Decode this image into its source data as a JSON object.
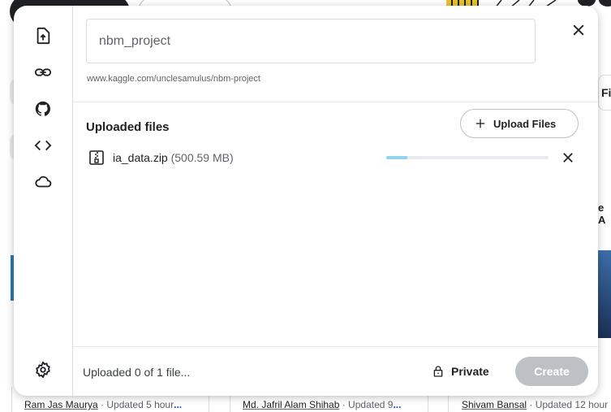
{
  "background": {
    "filter_label": "Filte",
    "side_text": "e A",
    "cards": [
      {
        "author": "Ram Jas Maurya",
        "meta": " · Updated 5 hour",
        "ellipsis": "..."
      },
      {
        "author": "Md. Jafril Alam Shihab",
        "meta": " · Updated 9",
        "ellipsis": "..."
      },
      {
        "author": "Shivam Bansal",
        "meta": " · Updated 12 hour",
        "ellipsis": ""
      }
    ]
  },
  "rail": {
    "items": [
      {
        "name": "upload-file-icon"
      },
      {
        "name": "link-icon"
      },
      {
        "name": "github-icon"
      },
      {
        "name": "code-icon"
      },
      {
        "name": "cloud-icon"
      }
    ],
    "settings_icon": "gear-icon"
  },
  "dataset": {
    "title_value": "nbm_project",
    "url": "www.kaggle.com/unclesamulus/nbm-project"
  },
  "uploads": {
    "section_title": "Uploaded files",
    "upload_button_label": "Upload Files",
    "files": [
      {
        "name": "ia_data.zip",
        "size": "(500.59 MB)",
        "progress": 0.13
      }
    ]
  },
  "footer": {
    "status": "Uploaded 0 of 1 file...",
    "privacy_label": "Private",
    "create_label": "Create"
  },
  "colors": {
    "accent_progress": "#8fd3f0",
    "disabled_button": "#bdc1c6"
  }
}
